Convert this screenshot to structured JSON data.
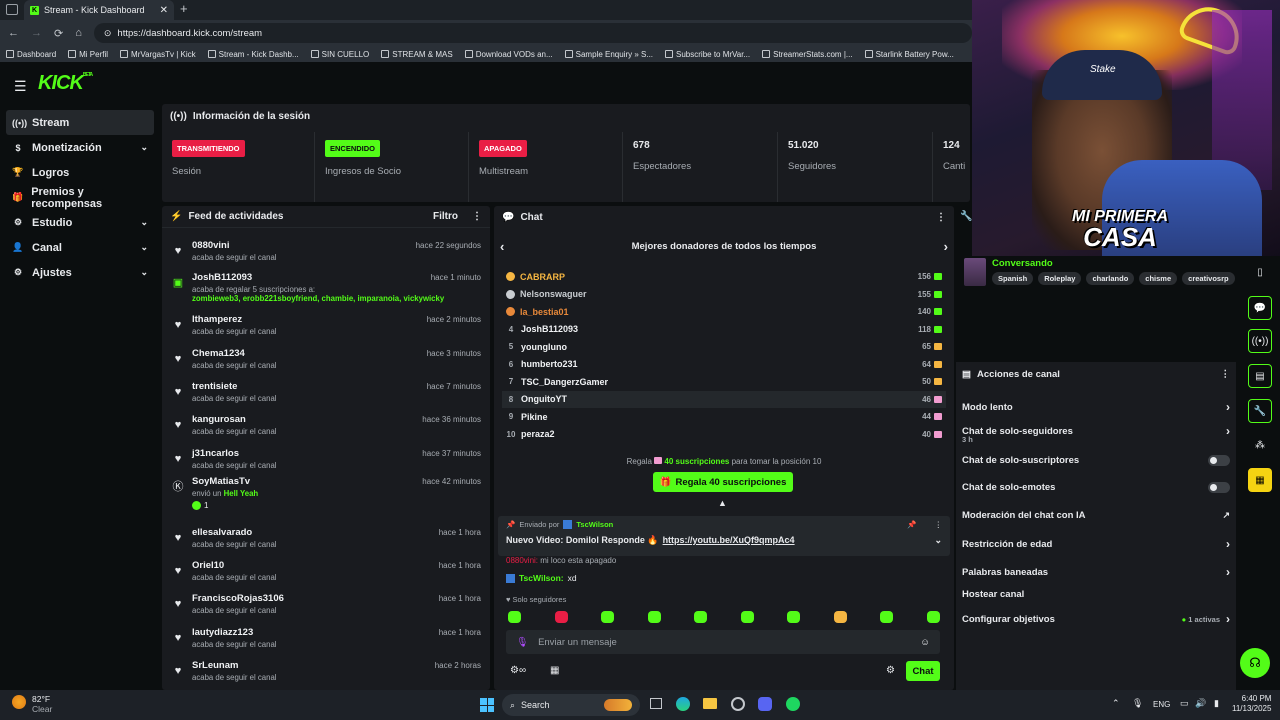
{
  "browser": {
    "tab_title": "Stream - Kick Dashboard",
    "url": "https://dashboard.kick.com/stream",
    "bookmarks": [
      "Dashboard",
      "Mi Perfil",
      "MrVargasTv | Kick",
      "Stream - Kick Dashb...",
      "SIN CUELLO",
      "STREAM & MAS",
      "Download VODs an...",
      "Sample Enquiry » S...",
      "Subscribe to MrVar...",
      "StreamerStats.com |...",
      "Starlink Battery Pow..."
    ]
  },
  "app": {
    "brand": "KICK",
    "brand_tag": "BETA"
  },
  "nav": [
    {
      "label": "Stream",
      "icon": "broadcast-icon"
    },
    {
      "label": "Monetización",
      "icon": "dollar-icon",
      "chev": "⌄"
    },
    {
      "label": "Logros",
      "icon": "trophy-icon"
    },
    {
      "label": "Premios y recompensas",
      "icon": "gift-icon"
    },
    {
      "label": "Estudio",
      "icon": "gear-icon",
      "chev": "⌄"
    },
    {
      "label": "Canal",
      "icon": "person-icon",
      "chev": "⌄"
    },
    {
      "label": "Ajustes",
      "icon": "settings-icon",
      "chev": "⌄"
    }
  ],
  "session": {
    "title": "Información de la sesión",
    "cells": [
      {
        "badge": "TRANSMITIENDO",
        "label": "Sesión"
      },
      {
        "badge": "ENCENDIDO",
        "label": "Ingresos de Socio"
      },
      {
        "badge": "APAGADO",
        "label": "Multistream"
      },
      {
        "value": "678",
        "label": "Espectadores"
      },
      {
        "value": "51.020",
        "label": "Seguidores"
      },
      {
        "value": "124",
        "label": "Canti"
      }
    ]
  },
  "feed": {
    "title": "Feed de actividades",
    "filter": "Filtro",
    "items": [
      {
        "user": "0880vini",
        "time": "hace 22 segundos",
        "text": "acaba de seguir el canal"
      },
      {
        "user": "JoshB112093",
        "time": "hace 1 minuto",
        "text": "acaba de regalar 5 suscripciones a:",
        "names": "zombieweb3, erobb221sboyfriend, chambie, imparanoia, vickywicky"
      },
      {
        "user": "lthamperez",
        "time": "hace 2 minutos",
        "text": "acaba de seguir el canal"
      },
      {
        "user": "Chema1234",
        "time": "hace 3 minutos",
        "text": "acaba de seguir el canal"
      },
      {
        "user": "trentisiete",
        "time": "hace 7 minutos",
        "text": "acaba de seguir el canal"
      },
      {
        "user": "kangurosan",
        "time": "hace 36 minutos",
        "text": "acaba de seguir el canal"
      },
      {
        "user": "j31ncarlos",
        "time": "hace 37 minutos",
        "text": "acaba de seguir el canal"
      },
      {
        "user": "SoyMatiasTv",
        "time": "hace 42 minutos",
        "text": "envió un",
        "highlight": "Hell Yeah",
        "count": "1"
      },
      {
        "user": "ellesalvarado",
        "time": "hace 1 hora",
        "text": "acaba de seguir el canal"
      },
      {
        "user": "Oriel10",
        "time": "hace 1 hora",
        "text": "acaba de seguir el canal"
      },
      {
        "user": "FranciscoRojas3106",
        "time": "hace 1 hora",
        "text": "acaba de seguir el canal"
      },
      {
        "user": "lautydiazz123",
        "time": "hace 1 hora",
        "text": "acaba de seguir el canal"
      },
      {
        "user": "SrLeunam",
        "time": "hace 2 horas",
        "text": "acaba de seguir el canal"
      }
    ]
  },
  "chat": {
    "title": "Chat",
    "donors_title": "Mejores donadores de todos los tiempos",
    "donors": [
      {
        "rank": "1",
        "name": "CABRARP",
        "amount": "156",
        "color": "#f5b642"
      },
      {
        "rank": "2",
        "name": "Nelsonswaguer",
        "amount": "155",
        "color": "#c8ccd0"
      },
      {
        "rank": "3",
        "name": "la_bestia01",
        "amount": "140",
        "color": "#e8893a"
      },
      {
        "rank": "4",
        "name": "JoshB112093",
        "amount": "118",
        "color": "#f0f2f4"
      },
      {
        "rank": "5",
        "name": "younglunо",
        "amount": "65",
        "color": "#f0f2f4"
      },
      {
        "rank": "6",
        "name": "humberto231",
        "amount": "64",
        "color": "#f0f2f4"
      },
      {
        "rank": "7",
        "name": "TSC_DangerzGamer",
        "amount": "50",
        "color": "#f0f2f4"
      },
      {
        "rank": "8",
        "name": "OnguitoYT",
        "amount": "46",
        "color": "#f0f2f4"
      },
      {
        "rank": "9",
        "name": "Pikine",
        "amount": "44",
        "color": "#f0f2f4"
      },
      {
        "rank": "10",
        "name": "peraza2",
        "amount": "40",
        "color": "#f0f2f4"
      }
    ],
    "regala_prefix": "Regala",
    "regala_count": "40 suscripciones",
    "regala_suffix": "para tomar la posición 10",
    "gift_button": "Regala 40 suscripciones",
    "pinned_by": "Enviado por",
    "pinned_user": "TscWilson",
    "pinned_msg": "Nuevo Video: Domilol Responde 🔥",
    "pinned_link": "https://youtu.be/XuQf9qmpAc4",
    "msg1_user": "0880vini:",
    "msg1_text": "mi loco esta apagado",
    "msg2_user": "TscWilson:",
    "msg2_text": "xd",
    "followers_only": "Solo seguidores",
    "input_placeholder": "Enviar un mensaje",
    "send": "Chat"
  },
  "stream_info": {
    "status": "Conversando",
    "tags": [
      "Spanish",
      "Roleplay",
      "charlando",
      "chisme",
      "creativosrp"
    ]
  },
  "actions": {
    "title": "Acciones de canal",
    "rows": [
      {
        "label": "Modo lento",
        "kind": "chev"
      },
      {
        "label": "Chat de solo-seguidores",
        "sub": "3 h",
        "kind": "chev"
      },
      {
        "label": "Chat de solo-suscriptores",
        "kind": "toggle"
      },
      {
        "label": "Chat de solo-emotes",
        "kind": "toggle"
      },
      {
        "label": "Moderación del chat con IA",
        "kind": "ext"
      },
      {
        "label": "Restricción de edad",
        "kind": "chev"
      },
      {
        "label": "Palabras baneadas",
        "kind": "chev"
      },
      {
        "label": "Hostear canal",
        "kind": "none"
      },
      {
        "label": "Configurar objetivos",
        "kind": "chev",
        "badge": "1 activas"
      }
    ]
  },
  "cam": {
    "sign_line1": "MI PRIMERA",
    "sign_line2": "CASA",
    "cap": "Stake"
  },
  "taskbar": {
    "weather_temp": "82°F",
    "weather_desc": "Clear",
    "search": "Search",
    "lang": "ENG",
    "time": "6:40 PM",
    "date": "11/13/2025"
  }
}
